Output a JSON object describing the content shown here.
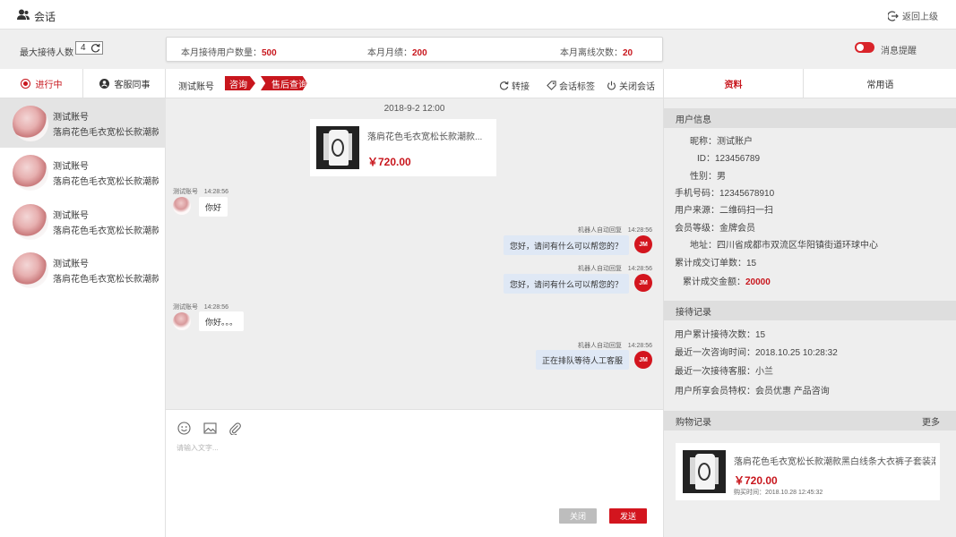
{
  "header": {
    "title": "会话",
    "back_label": "返回上级"
  },
  "stats": {
    "max_label": "最大接待人数",
    "max_value": "4",
    "month_users_label": "本月接待用户数量：",
    "month_users_value": "500",
    "month_perf_label": "本月月绩：",
    "month_perf_value": "200",
    "month_offline_label": "本月离线次数：",
    "month_offline_value": "20",
    "notify_label": "消息提醒",
    "notify_on": true
  },
  "left_tabs": {
    "active": "进行中",
    "colleague": "客服同事"
  },
  "sessions": [
    {
      "name": "测试账号",
      "preview": "落肩花色毛衣宽松长款潮款..."
    },
    {
      "name": "测试账号",
      "preview": "落肩花色毛衣宽松长款潮款..."
    },
    {
      "name": "测试账号",
      "preview": "落肩花色毛衣宽松长款潮款..."
    },
    {
      "name": "测试账号",
      "preview": "落肩花色毛衣宽松长款潮款..."
    }
  ],
  "toolbar": {
    "account": "测试账号",
    "tag_consult": "咨询",
    "tag_after": "售后查询",
    "transfer": "转接",
    "tag_session": "会话标签",
    "close_session": "关闭会话"
  },
  "chat": {
    "date": "2018-9-2  12:00",
    "product": {
      "name": "落肩花色毛衣宽松长款潮款...",
      "price": "￥720.00"
    },
    "messages": [
      {
        "side": "left",
        "sender": "测试账号",
        "time": "14:28:56",
        "text": "你好"
      },
      {
        "side": "right",
        "sender": "机器人自动回复",
        "time": "14:28:56",
        "text": "您好，请问有什么可以帮您的？"
      },
      {
        "side": "right",
        "sender": "机器人自动回复",
        "time": "14:28:56",
        "text": "您好，请问有什么可以帮您的？"
      },
      {
        "side": "left",
        "sender": "测试账号",
        "time": "14:28:56",
        "text": "你好。。。"
      },
      {
        "side": "right",
        "sender": "机器人自动回复",
        "time": "14:28:56",
        "text": "正在排队等待人工客服"
      }
    ],
    "bot_avatar_text": "JM"
  },
  "input": {
    "placeholder": "请输入文字...",
    "close_label": "关闭",
    "send_label": "发送"
  },
  "right_tabs": {
    "profile": "资料",
    "phrases": "常用语"
  },
  "user_info": {
    "heading": "用户信息",
    "nickname": "昵称：测试账户",
    "id": "ID：123456789",
    "gender": "性别：男",
    "phone": "手机号码：12345678910",
    "source": "用户来源：二维码扫一扫",
    "level": "会员等级：金牌会员",
    "address": "地址：四川省成都市双流区华阳镇街道环球中心",
    "orders": "累计成交订单数：15",
    "amount_label": "累计成交金额：",
    "amount_value": "20000"
  },
  "reception": {
    "heading": "接待记录",
    "count": "用户累计接待次数：15",
    "last_time": "最近一次咨询时间：2018.10.25   10:28:32",
    "last_agent": "最近一次接待客服：小兰",
    "privileges": "用户所享会员特权：会员优惠   产品咨询"
  },
  "purchase": {
    "heading": "购物记录",
    "more": "更多",
    "name": "落肩花色毛衣宽松长款潮款黑白线条大衣裤子套装潮流...",
    "price": "￥720.00",
    "time": "购买时间：2018.10.28   12:45:32"
  },
  "colors": {
    "accent": "#c8161d",
    "bubble_right": "#dfe8f5"
  }
}
